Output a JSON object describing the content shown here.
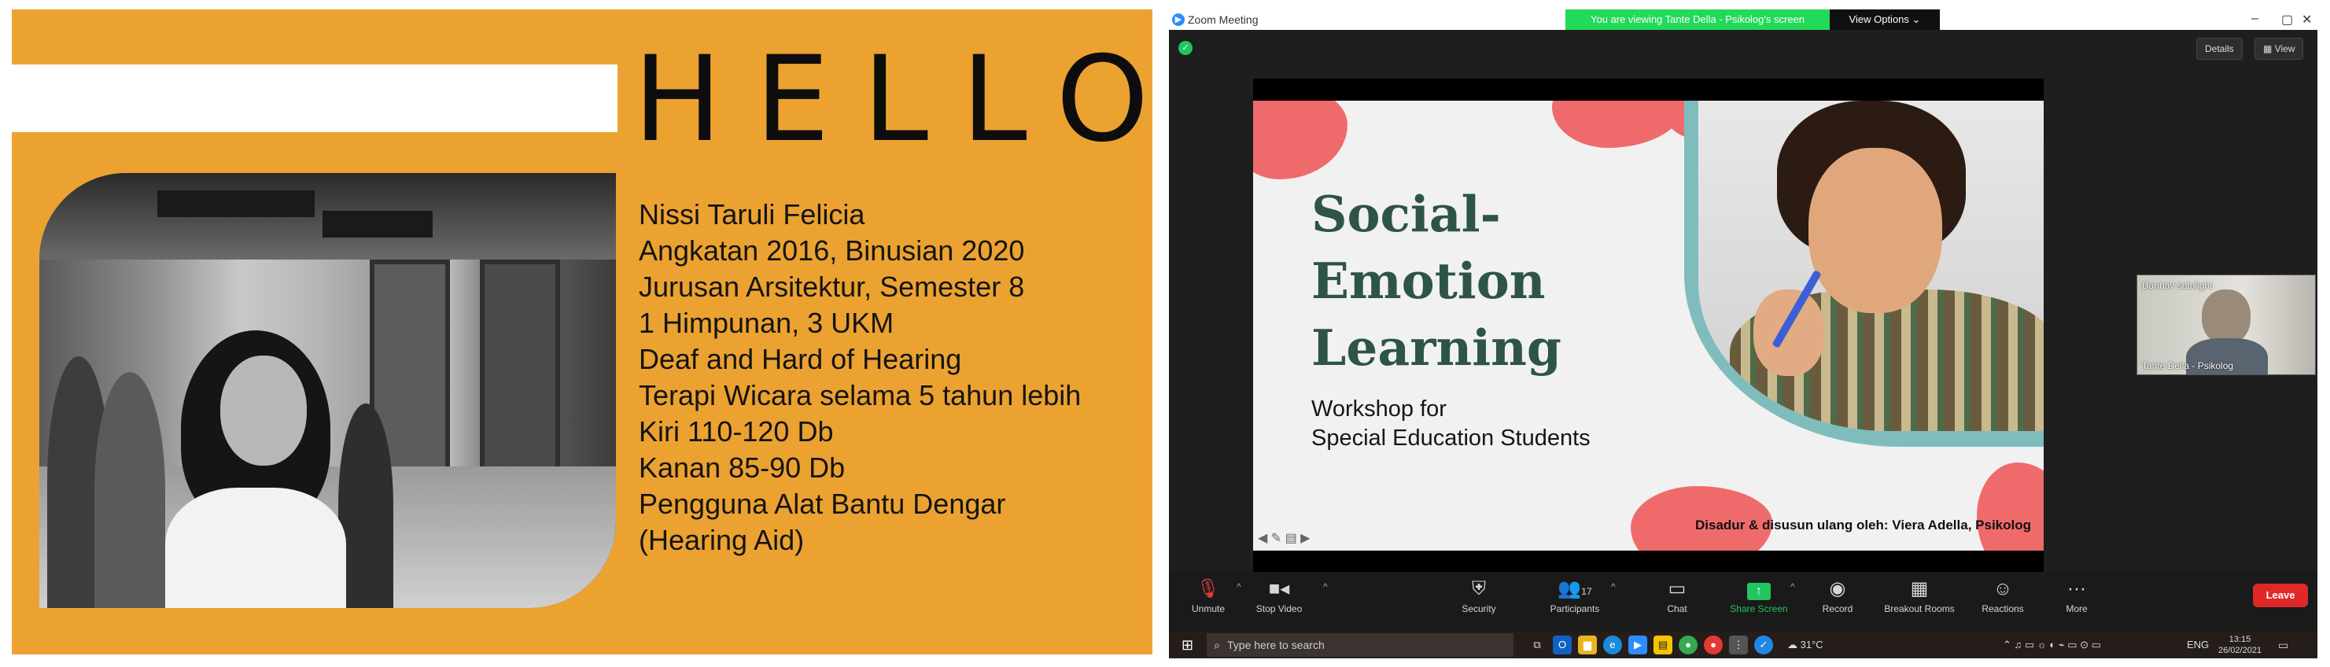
{
  "slide_left": {
    "heading": "HELLO!",
    "bio_lines": [
      "Nissi Taruli Felicia",
      "Angkatan 2016, Binusian 2020",
      "Jurusan Arsitektur, Semester 8",
      "1 Himpunan, 3 UKM",
      "Deaf and Hard of Hearing",
      "Terapi Wicara selama 5 tahun lebih",
      "Kiri 110-120 Db",
      "Kanan 85-90 Db",
      "Pengguna Alat Bantu Dengar",
      "(Hearing Aid)"
    ],
    "colors": {
      "background": "#eca230",
      "bar": "#ffffff",
      "text": "#141414"
    }
  },
  "zoom": {
    "app_name": "Zoom Meeting",
    "viewing_banner": "You are viewing Tante Della - Psikolog's screen",
    "view_options": "View Options",
    "top_buttons": [
      "Details",
      "View"
    ],
    "shared_slide": {
      "title_lines": [
        "Social-",
        "Emotion",
        "Learning"
      ],
      "subtitle_lines": [
        "Workshop for",
        "Special Education Students"
      ],
      "credit": "Disadur & disusun ulang oleh: Viera Adella, Psikolog",
      "colors": {
        "title": "#2e5447",
        "blob": "#ef6b6b",
        "frame": "#7ebdbc"
      }
    },
    "participant": {
      "header": "Dannav sotulight",
      "name": "Tante Della - Psikolog"
    },
    "toolbar": {
      "unmute": "Unmute",
      "stop_video": "Stop Video",
      "security": "Security",
      "participants": "Participants",
      "participants_count": "17",
      "chat": "Chat",
      "share_screen": "Share Screen",
      "record": "Record",
      "breakout_rooms": "Breakout Rooms",
      "reactions": "Reactions",
      "more": "More",
      "leave": "Leave"
    },
    "taskbar": {
      "search_placeholder": "Type here to search",
      "weather": "31°C",
      "language": "ENG",
      "time": "13:15",
      "date": "26/02/2021"
    }
  }
}
